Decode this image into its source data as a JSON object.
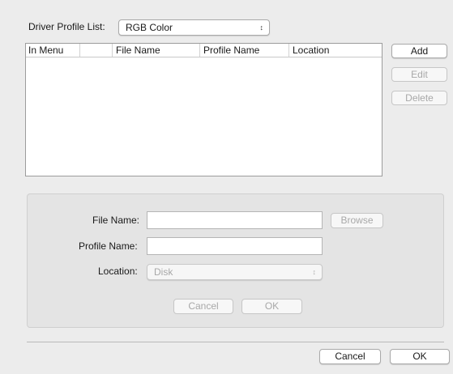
{
  "driver_profile_list": {
    "label": "Driver Profile List:",
    "selected": "RGB Color",
    "arrows": "↕"
  },
  "table": {
    "columns": [
      "In Menu",
      "File Name",
      "Profile Name",
      "Location"
    ],
    "rows": []
  },
  "side_buttons": {
    "add": "Add",
    "edit": "Edit",
    "delete": "Delete"
  },
  "form": {
    "file_name_label": "File Name:",
    "file_name_value": "",
    "browse": "Browse",
    "profile_name_label": "Profile Name:",
    "profile_name_value": "",
    "location_label": "Location:",
    "location_selected": "Disk",
    "location_arrows": "↕",
    "cancel": "Cancel",
    "ok": "OK"
  },
  "footer": {
    "cancel": "Cancel",
    "ok": "OK"
  }
}
